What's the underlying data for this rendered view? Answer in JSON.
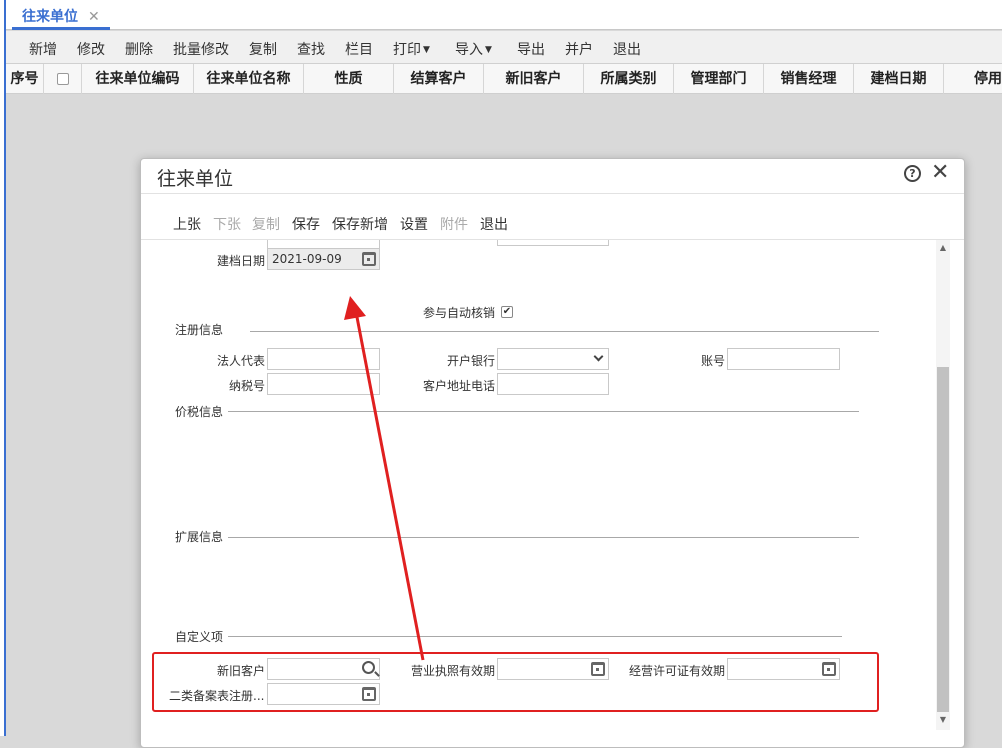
{
  "tab": {
    "title": "往来单位",
    "close": "✕"
  },
  "toolbar": {
    "items": [
      "新增",
      "修改",
      "删除",
      "批量修改",
      "复制",
      "查找",
      "栏目",
      "打印",
      "导入",
      "导出",
      "并户",
      "退出"
    ]
  },
  "grid": {
    "columns": [
      "序号",
      "往来单位编码",
      "往来单位名称",
      "性质",
      "结算客户",
      "新旧客户",
      "所属类别",
      "管理部门",
      "销售经理",
      "建档日期",
      "停用"
    ]
  },
  "modal": {
    "title": "往来单位",
    "help": "?",
    "close": "✕",
    "toolbar": [
      {
        "label": "上张",
        "enabled": true
      },
      {
        "label": "下张",
        "enabled": false
      },
      {
        "label": "复制",
        "enabled": false
      },
      {
        "label": "保存",
        "enabled": true
      },
      {
        "label": "保存新增",
        "enabled": true
      },
      {
        "label": "设置",
        "enabled": true
      },
      {
        "label": "附件",
        "enabled": false
      },
      {
        "label": "退出",
        "enabled": true
      }
    ],
    "form": {
      "create_date_label": "建档日期",
      "create_date_value": "2021-09-09",
      "auto_verify_label": "参与自动核销",
      "auto_verify_checked": "✔",
      "section_register": "注册信息",
      "legal_rep_label": "法人代表",
      "bank_label": "开户银行",
      "account_label": "账号",
      "tax_no_label": "纳税号",
      "address_phone_label": "客户地址电话",
      "section_price_tax": "价税信息",
      "section_extend": "扩展信息",
      "section_custom": "自定义项",
      "new_old_customer_label": "新旧客户",
      "license_valid_label": "营业执照有效期",
      "permit_valid_label": "经营许可证有效期",
      "filing_label": "二类备案表注册..."
    }
  },
  "colors": {
    "accent": "#3a6fd1",
    "annotation": "#e02020"
  }
}
